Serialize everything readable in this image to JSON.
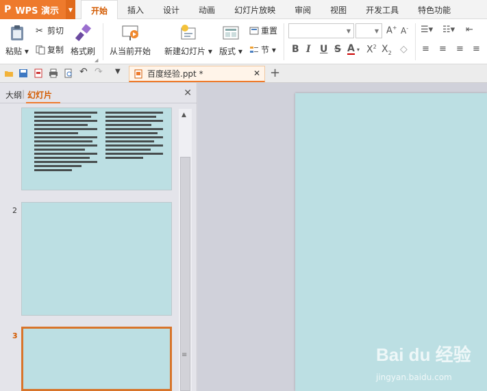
{
  "app": {
    "name": "WPS 演示",
    "logo": "P"
  },
  "menu": {
    "tabs": [
      "开始",
      "插入",
      "设计",
      "动画",
      "幻灯片放映",
      "审阅",
      "视图",
      "开发工具",
      "特色功能"
    ],
    "active_tab": "开始"
  },
  "ribbon": {
    "paste_label": "粘贴",
    "cut_label": "剪切",
    "copy_label": "复制",
    "format_painter_label": "格式刷",
    "play_from_current_label": "从当前开始",
    "new_slide_label": "新建幻灯片",
    "layout_label": "版式",
    "reset_label": "重置",
    "section_label": "节"
  },
  "document": {
    "tab_title": "百度经验.ppt *"
  },
  "panel": {
    "outline_tab": "大纲",
    "slides_tab": "幻灯片",
    "slide_numbers": [
      "2",
      "3"
    ]
  },
  "watermark": {
    "brand": "Bai du 经验",
    "site": "jingyan.baidu.com"
  },
  "colors": {
    "accent": "#ee7a2c",
    "slide_bg": "#bcdfe3",
    "canvas_bg": "#d0d1da"
  }
}
